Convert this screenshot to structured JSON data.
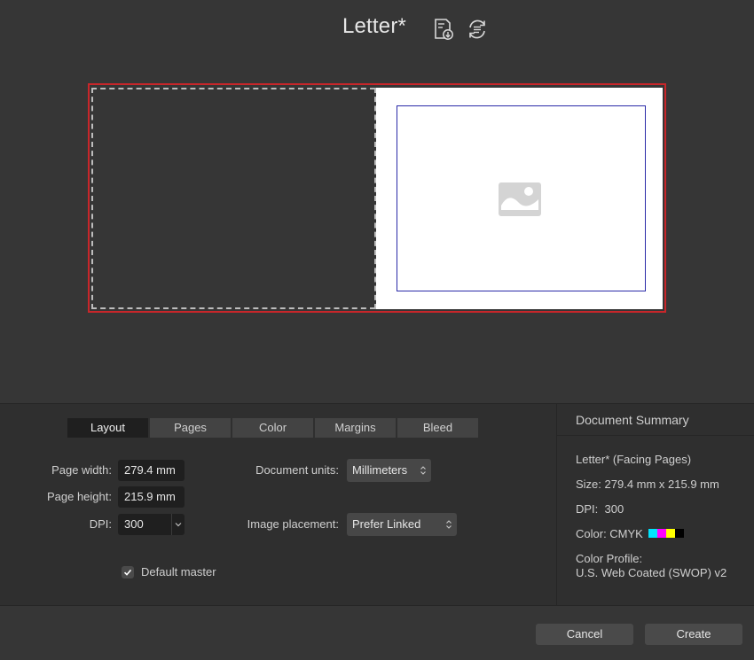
{
  "header": {
    "title": "Letter*",
    "icons": [
      "save-preset-icon",
      "sync-preset-icon"
    ]
  },
  "preview": {
    "bleed_color": "#c8262a",
    "margin_color": "#2a2aa8",
    "placeholder_icon": "image-placeholder-icon"
  },
  "tabs": [
    {
      "label": "Layout",
      "active": true
    },
    {
      "label": "Pages",
      "active": false
    },
    {
      "label": "Color",
      "active": false
    },
    {
      "label": "Margins",
      "active": false
    },
    {
      "label": "Bleed",
      "active": false
    }
  ],
  "layout": {
    "page_width_label": "Page width:",
    "page_width_value": "279.4 mm",
    "page_height_label": "Page height:",
    "page_height_value": "215.9 mm",
    "dpi_label": "DPI:",
    "dpi_value": "300",
    "document_units_label": "Document units:",
    "document_units_value": "Millimeters",
    "image_placement_label": "Image placement:",
    "image_placement_value": "Prefer Linked",
    "default_master_label": "Default master",
    "default_master_checked": true
  },
  "summary": {
    "title": "Document Summary",
    "name_line": "Letter* (Facing Pages)",
    "size_line": "Size: 279.4 mm x 215.9 mm",
    "dpi_line": "DPI:  300",
    "color_line": "Color: CMYK",
    "swatch_colors": [
      "#00e5ff",
      "#ff00ff",
      "#ffff00",
      "#000000"
    ],
    "profile_label": "Color Profile:",
    "profile_value": "U.S. Web Coated (SWOP) v2"
  },
  "footer": {
    "cancel_label": "Cancel",
    "create_label": "Create"
  }
}
